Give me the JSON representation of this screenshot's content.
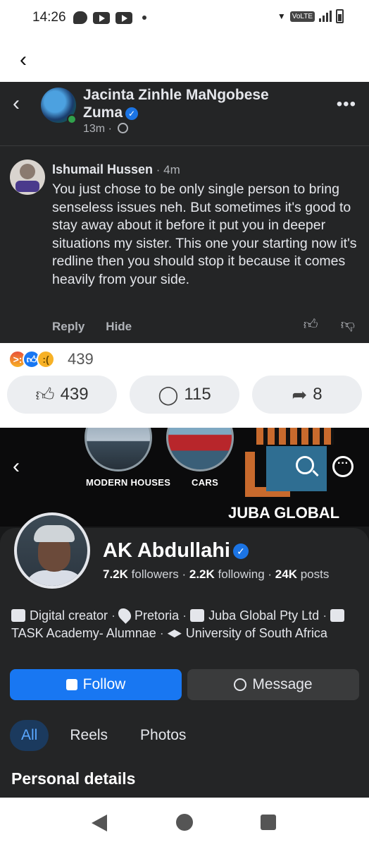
{
  "status_bar": {
    "time": "14:26",
    "network_badge": "VoLTE"
  },
  "post": {
    "author": "Jacinta Zinhle MaNgobese Zuma",
    "time": "13m",
    "comment": {
      "author": "Ishumail Hussen",
      "time_ago": "4m",
      "text": "You just chose to be only single person to bring senseless issues neh. But sometimes it's good to stay away about it before it put you in deeper situations my sister. This one your starting now it's redline then you should stop it because it comes heavily from your side.",
      "reply_label": "Reply",
      "hide_label": "Hide"
    }
  },
  "reactions": {
    "total": "439",
    "like_count": "439",
    "comment_count": "115",
    "share_count": "8"
  },
  "profile": {
    "cover_labels": {
      "houses": "MODERN HOUSES",
      "cars": "CARS",
      "brand": "JUBA GLOBAL"
    },
    "name": "AK Abdullahi",
    "followers": "7.2K",
    "followers_label": "followers",
    "following": "2.2K",
    "following_label": "following",
    "posts": "24K",
    "posts_label": "posts",
    "info": {
      "category": "Digital creator",
      "location": "Pretoria",
      "company": "Juba Global Pty Ltd",
      "education1": "TASK Academy- Alumnae",
      "education2": "University of South Africa"
    },
    "follow_label": "Follow",
    "message_label": "Message",
    "tabs": [
      "All",
      "Reels",
      "Photos"
    ],
    "section_title": "Personal details"
  },
  "colors": {
    "accent": "#1877f2",
    "dark_panel": "#242526",
    "profile_bg": "#18191a"
  },
  "icons": [
    "back-chevron-icon",
    "globe-icon",
    "more-icon",
    "thumbs-up-icon",
    "thumbs-down-icon",
    "comment-icon",
    "share-icon",
    "search-icon",
    "messenger-icon",
    "location-icon",
    "building-icon",
    "graduation-icon"
  ]
}
